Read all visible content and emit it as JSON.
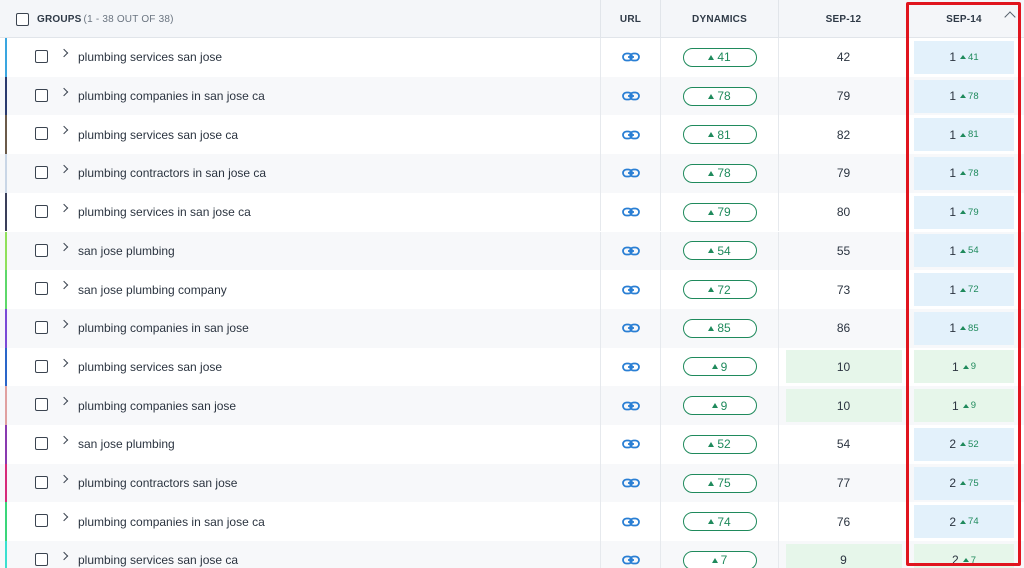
{
  "header": {
    "groups_label": "GROUPS",
    "groups_count": "(1 - 38 OUT OF 38)",
    "url_label": "URL",
    "dynamics_label": "DYNAMICS",
    "sep12_label": "SEP-12",
    "sep14_label": "SEP-14"
  },
  "colors": {
    "positive": "#1f8a5c",
    "highlight_border": "#e0141e",
    "cell_blue": "#e3f1fb",
    "cell_green": "#e6f6ea"
  },
  "rows": [
    {
      "keyword": "plumbing services san jose",
      "dynamics": "41",
      "sep12": "42",
      "sep14": "1",
      "sep14_delta": "41",
      "stripe": "#3aa6e0",
      "sep12_green": false,
      "sep14_style": "blue"
    },
    {
      "keyword": "plumbing companies in san jose ca",
      "dynamics": "78",
      "sep12": "79",
      "sep14": "1",
      "sep14_delta": "78",
      "stripe": "#2a3a6e",
      "sep12_green": false,
      "sep14_style": "blue"
    },
    {
      "keyword": "plumbing services san jose ca",
      "dynamics": "81",
      "sep12": "82",
      "sep14": "1",
      "sep14_delta": "81",
      "stripe": "#6b5a4a",
      "sep12_green": false,
      "sep14_style": "blue"
    },
    {
      "keyword": "plumbing contractors in san jose ca",
      "dynamics": "78",
      "sep12": "79",
      "sep14": "1",
      "sep14_delta": "78",
      "stripe": "#c9d6e6",
      "sep12_green": false,
      "sep14_style": "blue"
    },
    {
      "keyword": "plumbing services in san jose ca",
      "dynamics": "79",
      "sep12": "80",
      "sep14": "1",
      "sep14_delta": "79",
      "stripe": "#3a3f5a",
      "sep12_green": false,
      "sep14_style": "blue"
    },
    {
      "keyword": "san jose plumbing",
      "dynamics": "54",
      "sep12": "55",
      "sep14": "1",
      "sep14_delta": "54",
      "stripe": "#8fe05a",
      "sep12_green": false,
      "sep14_style": "blue"
    },
    {
      "keyword": "san jose plumbing company",
      "dynamics": "72",
      "sep12": "73",
      "sep14": "1",
      "sep14_delta": "72",
      "stripe": "#5ed86a",
      "sep12_green": false,
      "sep14_style": "blue"
    },
    {
      "keyword": "plumbing companies in san jose",
      "dynamics": "85",
      "sep12": "86",
      "sep14": "1",
      "sep14_delta": "85",
      "stripe": "#7a4ad6",
      "sep12_green": false,
      "sep14_style": "blue"
    },
    {
      "keyword": "plumbing services san jose",
      "dynamics": "9",
      "sep12": "10",
      "sep14": "1",
      "sep14_delta": "9",
      "stripe": "#2a66c9",
      "sep12_green": true,
      "sep14_style": "green"
    },
    {
      "keyword": "plumbing companies san jose",
      "dynamics": "9",
      "sep12": "10",
      "sep14": "1",
      "sep14_delta": "9",
      "stripe": "#e0a0a0",
      "sep12_green": true,
      "sep14_style": "green"
    },
    {
      "keyword": "san jose plumbing",
      "dynamics": "52",
      "sep12": "54",
      "sep14": "2",
      "sep14_delta": "52",
      "stripe": "#8a3ab0",
      "sep12_green": false,
      "sep14_style": "blue"
    },
    {
      "keyword": "plumbing contractors san jose",
      "dynamics": "75",
      "sep12": "77",
      "sep14": "2",
      "sep14_delta": "75",
      "stripe": "#d62a7a",
      "sep12_green": false,
      "sep14_style": "blue"
    },
    {
      "keyword": "plumbing companies in san jose ca",
      "dynamics": "74",
      "sep12": "76",
      "sep14": "2",
      "sep14_delta": "74",
      "stripe": "#3ad67a",
      "sep12_green": false,
      "sep14_style": "blue"
    },
    {
      "keyword": "plumbing services san jose ca",
      "dynamics": "7",
      "sep12": "9",
      "sep14": "2",
      "sep14_delta": "7",
      "stripe": "#3ae0d0",
      "sep12_green": true,
      "sep14_style": "green"
    }
  ]
}
